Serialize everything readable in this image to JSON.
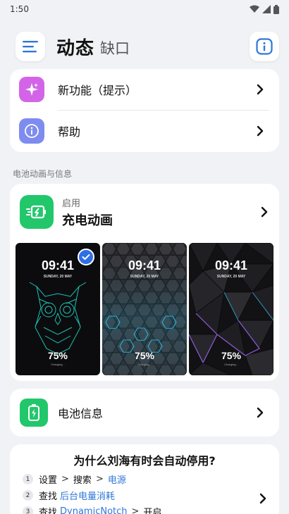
{
  "status": {
    "time": "1:50"
  },
  "header": {
    "title": "动态",
    "subtitle": "缺口"
  },
  "menu": {
    "items": [
      {
        "label": "新功能（提示）",
        "icon": "sparkles-icon",
        "color": "#d364e8"
      },
      {
        "label": "帮助",
        "icon": "info-icon",
        "color": "#7e8cf0"
      }
    ]
  },
  "section": {
    "label": "电池动画与信息"
  },
  "animation": {
    "status": "启用",
    "title": "充电动画",
    "accent": "#22c76b",
    "wallpapers": [
      {
        "time": "09:41",
        "date": "SUNDAY, 20 MAY",
        "percent": "75%",
        "sub": "Charging...",
        "selected": true,
        "style": "owl-neon-cyan"
      },
      {
        "time": "09:41",
        "date": "SUNDAY, 20 MAY",
        "percent": "75%",
        "sub": "Charging...",
        "selected": false,
        "style": "hexagon-cyan"
      },
      {
        "time": "09:41",
        "date": "SUNDAY, 20 MAY",
        "percent": "75%",
        "sub": "Charging...",
        "selected": false,
        "style": "polygon-purple"
      }
    ]
  },
  "battery": {
    "label": "电池信息"
  },
  "why": {
    "title": "为什么刘海有时会自动停用?",
    "steps": [
      {
        "num": "1",
        "parts": [
          {
            "t": "设置",
            "c": ""
          },
          {
            "t": ">",
            "c": "gap"
          },
          {
            "t": "搜索",
            "c": ""
          },
          {
            "t": ">",
            "c": "gap"
          },
          {
            "t": "电源",
            "c": "blue"
          }
        ]
      },
      {
        "num": "2",
        "parts": [
          {
            "t": "查找 ",
            "c": ""
          },
          {
            "t": "后台电量消耗",
            "c": "blue"
          }
        ]
      },
      {
        "num": "3",
        "parts": [
          {
            "t": "查找 ",
            "c": ""
          },
          {
            "t": "DynamicNotch",
            "c": "blue"
          },
          {
            "t": ">",
            "c": "gap"
          },
          {
            "t": "开启",
            "c": ""
          }
        ]
      }
    ]
  },
  "colors": {
    "accent_blue": "#2f78d8",
    "background": "#f1f2f6"
  }
}
